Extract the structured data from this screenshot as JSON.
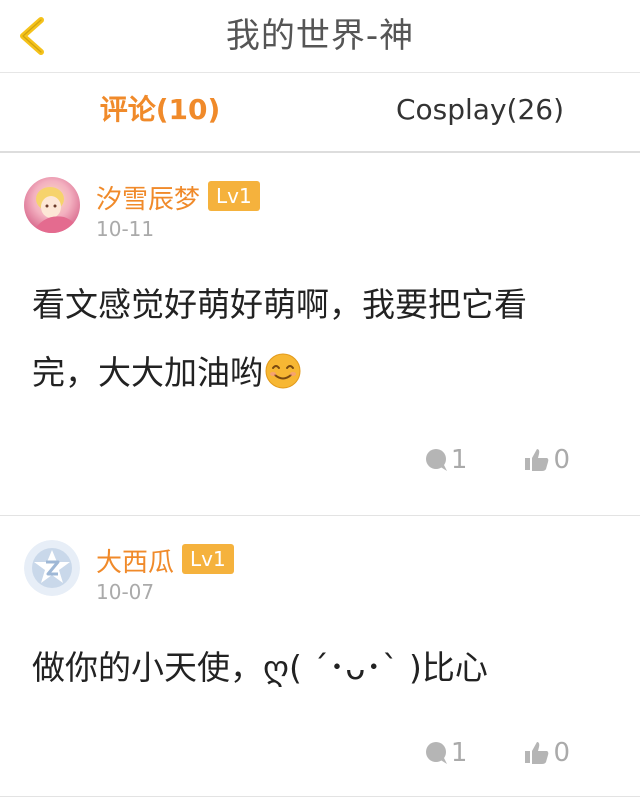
{
  "header": {
    "title": "我的世界-神",
    "back_icon": "chevron-left-icon",
    "accent_color": "#f5c21a"
  },
  "tabs": [
    {
      "label": "评论(10)",
      "active": true
    },
    {
      "label": "Cosplay(26)",
      "active": false
    }
  ],
  "colors": {
    "accent": "#f08a2a",
    "badge": "#f5b23d",
    "muted": "#aaaaaa"
  },
  "comments": [
    {
      "username": "汐雪辰梦",
      "level": "Lv1",
      "date": "10-11",
      "text_line1": "看文感觉好萌好萌啊，我要把它看",
      "text_line2": "完，大大加油哟",
      "emoji": "smiling-emoji-icon",
      "reply_count": "1",
      "like_count": "0"
    },
    {
      "username": "大西瓜",
      "level": "Lv1",
      "date": "10-07",
      "text_line1": "做你的小天使，ღ( ´･ᴗ･` )比心",
      "reply_count": "1",
      "like_count": "0"
    }
  ]
}
